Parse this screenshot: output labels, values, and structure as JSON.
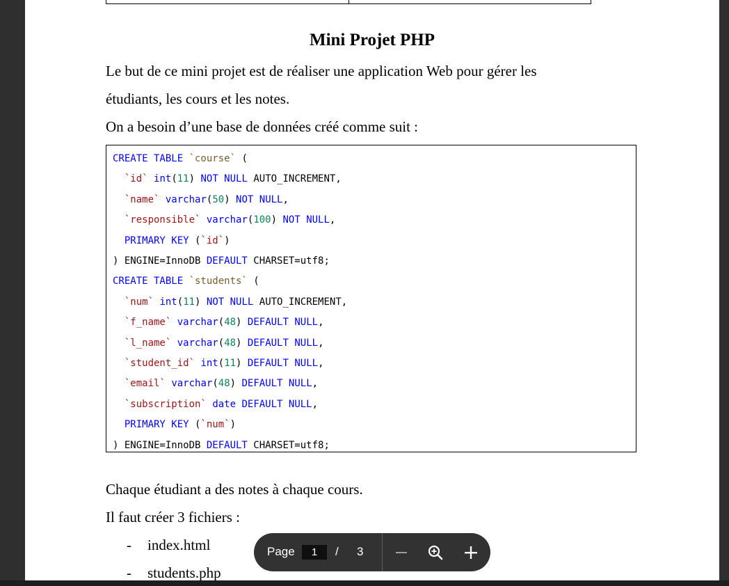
{
  "document": {
    "title": "Mini Projet PHP",
    "intro_line1": "Le but de ce mini projet est de réaliser une application Web pour gérer les",
    "intro_line2": "étudiants, les cours et les notes.",
    "db_line": "On a besoin d’une base de données créé comme suit :",
    "after_code_line1": "Chaque étudiant a des notes à chaque cours.",
    "after_code_line2": "Il faut créer 3 fichiers :",
    "bullets": [
      {
        "dash": "-",
        "text": "index.html"
      },
      {
        "dash": "-",
        "text": "students.php"
      }
    ]
  },
  "code": {
    "lines": [
      [
        {
          "t": "CREATE TABLE ",
          "c": "kw"
        },
        {
          "t": "`course`",
          "c": "tbl"
        },
        {
          "t": " (",
          "c": ""
        }
      ],
      [
        {
          "t": "  ",
          "c": ""
        },
        {
          "t": "`id`",
          "c": "col"
        },
        {
          "t": " ",
          "c": ""
        },
        {
          "t": "int",
          "c": "kw"
        },
        {
          "t": "(",
          "c": ""
        },
        {
          "t": "11",
          "c": "num"
        },
        {
          "t": ") ",
          "c": ""
        },
        {
          "t": "NOT NULL",
          "c": "kw"
        },
        {
          "t": " AUTO_INCREMENT,",
          "c": ""
        }
      ],
      [
        {
          "t": "  ",
          "c": ""
        },
        {
          "t": "`name`",
          "c": "col"
        },
        {
          "t": " ",
          "c": ""
        },
        {
          "t": "varchar",
          "c": "kw"
        },
        {
          "t": "(",
          "c": ""
        },
        {
          "t": "50",
          "c": "num"
        },
        {
          "t": ") ",
          "c": ""
        },
        {
          "t": "NOT NULL",
          "c": "kw"
        },
        {
          "t": ",",
          "c": ""
        }
      ],
      [
        {
          "t": "  ",
          "c": ""
        },
        {
          "t": "`responsible`",
          "c": "col"
        },
        {
          "t": " ",
          "c": ""
        },
        {
          "t": "varchar",
          "c": "kw"
        },
        {
          "t": "(",
          "c": ""
        },
        {
          "t": "100",
          "c": "num"
        },
        {
          "t": ") ",
          "c": ""
        },
        {
          "t": "NOT NULL",
          "c": "kw"
        },
        {
          "t": ",",
          "c": ""
        }
      ],
      [
        {
          "t": "  ",
          "c": ""
        },
        {
          "t": "PRIMARY KEY",
          "c": "kw"
        },
        {
          "t": " (",
          "c": ""
        },
        {
          "t": "`id`",
          "c": "col"
        },
        {
          "t": ")",
          "c": ""
        }
      ],
      [
        {
          "t": ") ENGINE=InnoDB ",
          "c": ""
        },
        {
          "t": "DEFAULT",
          "c": "kw"
        },
        {
          "t": " CHARSET=utf8;",
          "c": ""
        }
      ],
      [
        {
          "t": "CREATE TABLE ",
          "c": "kw"
        },
        {
          "t": "`students`",
          "c": "tbl"
        },
        {
          "t": " (",
          "c": ""
        }
      ],
      [
        {
          "t": "  ",
          "c": ""
        },
        {
          "t": "`num`",
          "c": "col"
        },
        {
          "t": " ",
          "c": ""
        },
        {
          "t": "int",
          "c": "kw"
        },
        {
          "t": "(",
          "c": ""
        },
        {
          "t": "11",
          "c": "num"
        },
        {
          "t": ") ",
          "c": ""
        },
        {
          "t": "NOT NULL",
          "c": "kw"
        },
        {
          "t": " AUTO_INCREMENT,",
          "c": ""
        }
      ],
      [
        {
          "t": "  ",
          "c": ""
        },
        {
          "t": "`f_name`",
          "c": "col"
        },
        {
          "t": " ",
          "c": ""
        },
        {
          "t": "varchar",
          "c": "kw"
        },
        {
          "t": "(",
          "c": ""
        },
        {
          "t": "48",
          "c": "num"
        },
        {
          "t": ") ",
          "c": ""
        },
        {
          "t": "DEFAULT NULL",
          "c": "kw"
        },
        {
          "t": ",",
          "c": ""
        }
      ],
      [
        {
          "t": "  ",
          "c": ""
        },
        {
          "t": "`l_name`",
          "c": "col"
        },
        {
          "t": " ",
          "c": ""
        },
        {
          "t": "varchar",
          "c": "kw"
        },
        {
          "t": "(",
          "c": ""
        },
        {
          "t": "48",
          "c": "num"
        },
        {
          "t": ") ",
          "c": ""
        },
        {
          "t": "DEFAULT NULL",
          "c": "kw"
        },
        {
          "t": ",",
          "c": ""
        }
      ],
      [
        {
          "t": "  ",
          "c": ""
        },
        {
          "t": "`student_id`",
          "c": "col"
        },
        {
          "t": " ",
          "c": ""
        },
        {
          "t": "int",
          "c": "kw"
        },
        {
          "t": "(",
          "c": ""
        },
        {
          "t": "11",
          "c": "num"
        },
        {
          "t": ") ",
          "c": ""
        },
        {
          "t": "DEFAULT NULL",
          "c": "kw"
        },
        {
          "t": ",",
          "c": ""
        }
      ],
      [
        {
          "t": "  ",
          "c": ""
        },
        {
          "t": "`email`",
          "c": "col"
        },
        {
          "t": " ",
          "c": ""
        },
        {
          "t": "varchar",
          "c": "kw"
        },
        {
          "t": "(",
          "c": ""
        },
        {
          "t": "48",
          "c": "num"
        },
        {
          "t": ") ",
          "c": ""
        },
        {
          "t": "DEFAULT NULL",
          "c": "kw"
        },
        {
          "t": ",",
          "c": ""
        }
      ],
      [
        {
          "t": "  ",
          "c": ""
        },
        {
          "t": "`subscription`",
          "c": "col"
        },
        {
          "t": " ",
          "c": ""
        },
        {
          "t": "date DEFAULT NULL",
          "c": "kw"
        },
        {
          "t": ",",
          "c": ""
        }
      ],
      [
        {
          "t": "  ",
          "c": ""
        },
        {
          "t": "PRIMARY KEY",
          "c": "kw"
        },
        {
          "t": " (",
          "c": ""
        },
        {
          "t": "`num`",
          "c": "col"
        },
        {
          "t": ")",
          "c": ""
        }
      ],
      [
        {
          "t": ") ENGINE=InnoDB ",
          "c": ""
        },
        {
          "t": "DEFAULT",
          "c": "kw"
        },
        {
          "t": " CHARSET=utf8;",
          "c": ""
        }
      ]
    ]
  },
  "toolbar": {
    "page_label": "Page",
    "current_page": "1",
    "separator": "/",
    "total_pages": "3"
  },
  "colors": {
    "keyword": "#0000ff",
    "number": "#098658",
    "table_name": "#795e26",
    "column_name": "#a31515",
    "toolbar_bg": "#323232"
  }
}
